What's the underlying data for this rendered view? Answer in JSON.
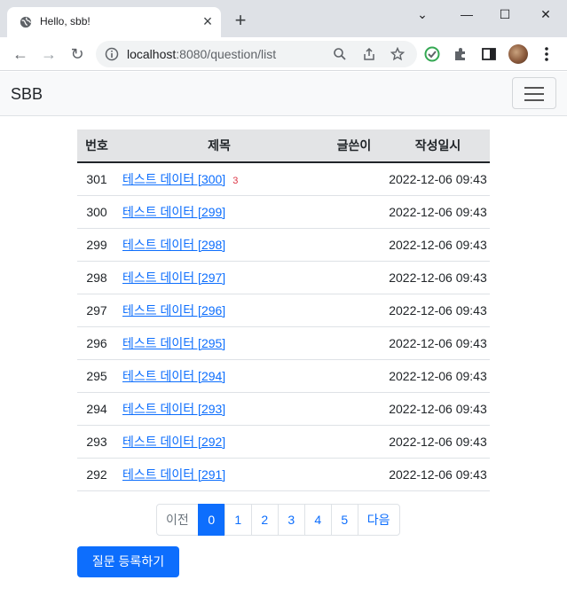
{
  "browser": {
    "tab_title": "Hello, sbb!",
    "url_host": "localhost",
    "url_path": ":8080/question/list"
  },
  "navbar": {
    "brand": "SBB"
  },
  "table": {
    "headers": [
      "번호",
      "제목",
      "글쓴이",
      "작성일시"
    ],
    "rows": [
      {
        "num": "301",
        "subject": "테스트 데이터 [300]",
        "answers": "3",
        "author": "",
        "date": "2022-12-06 09:43"
      },
      {
        "num": "300",
        "subject": "테스트 데이터 [299]",
        "answers": "",
        "author": "",
        "date": "2022-12-06 09:43"
      },
      {
        "num": "299",
        "subject": "테스트 데이터 [298]",
        "answers": "",
        "author": "",
        "date": "2022-12-06 09:43"
      },
      {
        "num": "298",
        "subject": "테스트 데이터 [297]",
        "answers": "",
        "author": "",
        "date": "2022-12-06 09:43"
      },
      {
        "num": "297",
        "subject": "테스트 데이터 [296]",
        "answers": "",
        "author": "",
        "date": "2022-12-06 09:43"
      },
      {
        "num": "296",
        "subject": "테스트 데이터 [295]",
        "answers": "",
        "author": "",
        "date": "2022-12-06 09:43"
      },
      {
        "num": "295",
        "subject": "테스트 데이터 [294]",
        "answers": "",
        "author": "",
        "date": "2022-12-06 09:43"
      },
      {
        "num": "294",
        "subject": "테스트 데이터 [293]",
        "answers": "",
        "author": "",
        "date": "2022-12-06 09:43"
      },
      {
        "num": "293",
        "subject": "테스트 데이터 [292]",
        "answers": "",
        "author": "",
        "date": "2022-12-06 09:43"
      },
      {
        "num": "292",
        "subject": "테스트 데이터 [291]",
        "answers": "",
        "author": "",
        "date": "2022-12-06 09:43"
      }
    ]
  },
  "pagination": {
    "prev": "이전",
    "pages": [
      "0",
      "1",
      "2",
      "3",
      "4",
      "5"
    ],
    "active": "0",
    "next": "다음"
  },
  "create_button": "질문 등록하기",
  "colors": {
    "primary": "#0d6efd",
    "danger": "#dc3545",
    "header_bg": "#e3e4e6"
  }
}
